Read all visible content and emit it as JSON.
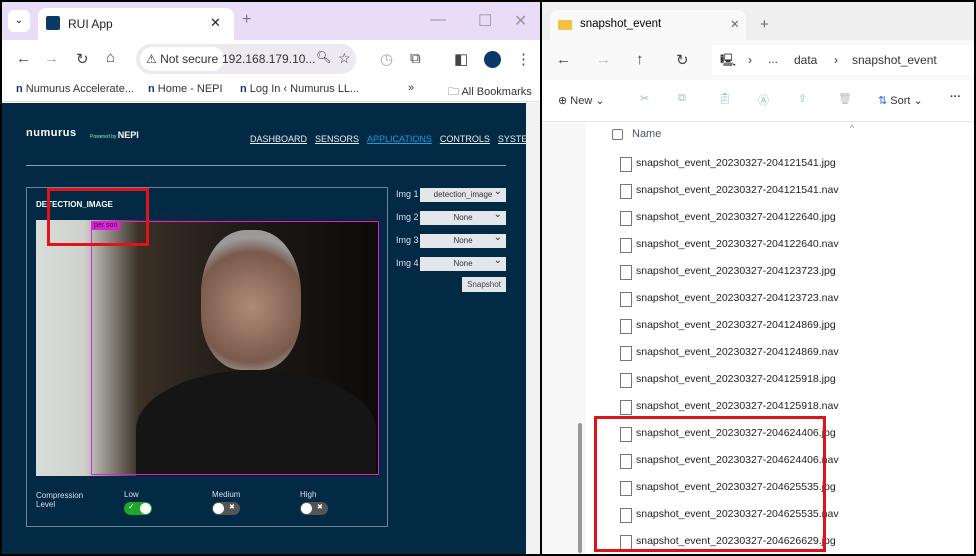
{
  "browser": {
    "tab_title": "RUI App",
    "address": "192.168.179.10...",
    "security": "Not secure",
    "bookmarks": [
      "Numurus Accelerate...",
      "Home - NEPI",
      "Log In ‹ Numurus LL..."
    ],
    "all_bookmarks": "All Bookmarks"
  },
  "app": {
    "logo": "numurus",
    "powered_by": "Powered by",
    "nepi": "NEPI",
    "nav": [
      "DASHBOARD",
      "SENSORS",
      "APPLICATIONS",
      "CONTROLS",
      "SYSTEM"
    ],
    "active_nav": "APPLICATIONS",
    "panel_title": "DETECTION_IMAGE",
    "detection_label": "per son",
    "img_selects": [
      {
        "label": "Img 1",
        "value": "detection_image"
      },
      {
        "label": "Img 2",
        "value": "None"
      },
      {
        "label": "Img 3",
        "value": "None"
      },
      {
        "label": "Img 4",
        "value": "None"
      }
    ],
    "snapshot": "Snapshot",
    "compression_label": "Compression Level",
    "compression": [
      {
        "label": "Low",
        "on": true
      },
      {
        "label": "Medium",
        "on": false
      },
      {
        "label": "High",
        "on": false
      }
    ]
  },
  "explorer": {
    "tab_title": "snapshot_event",
    "breadcrumb": [
      "...",
      "data",
      "snapshot_event"
    ],
    "new": "New",
    "sort": "Sort",
    "column_name": "Name",
    "files": [
      "snapshot_event_20230327-204121541.jpg",
      "snapshot_event_20230327-204121541.nav",
      "snapshot_event_20230327-204122640.jpg",
      "snapshot_event_20230327-204122640.nav",
      "snapshot_event_20230327-204123723.jpg",
      "snapshot_event_20230327-204123723.nav",
      "snapshot_event_20230327-204124869.jpg",
      "snapshot_event_20230327-204124869.nav",
      "snapshot_event_20230327-204125918.jpg",
      "snapshot_event_20230327-204125918.nav",
      "snapshot_event_20230327-204624406.jpg",
      "snapshot_event_20230327-204624406.nav",
      "snapshot_event_20230327-204625535.jpg",
      "snapshot_event_20230327-204625535.nav",
      "snapshot_event_20230327-204626629.jpg"
    ]
  },
  "colors": {
    "page_bg": "#032a45",
    "accent": "#1e9be0",
    "highlight": "#e0131b",
    "detection": "#e01ee0"
  }
}
